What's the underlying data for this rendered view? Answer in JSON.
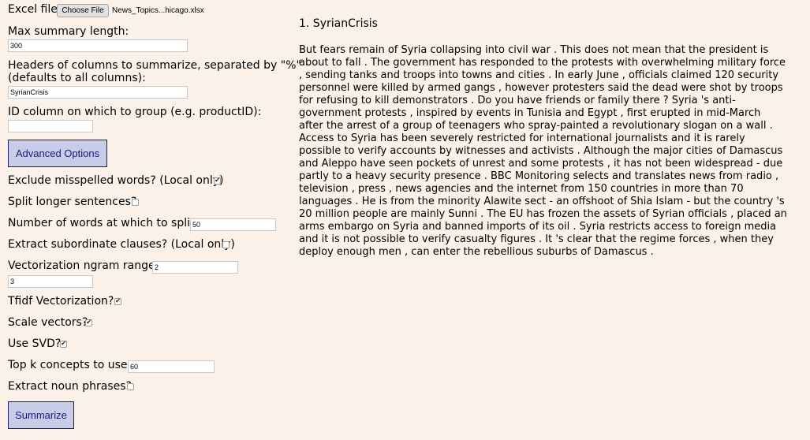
{
  "form": {
    "excel_file_label": "Excel file",
    "choose_file_label": "Choose File",
    "file_name": "News_Topics...hicago.xlsx",
    "max_summary_label": "Max summary length:",
    "max_summary_value": "300",
    "headers_label_line1": "Headers of columns to summarize, separated by \"%\"",
    "headers_label_line2": "(defaults to all columns):",
    "headers_value": "SyrianCrisis",
    "id_column_label": "ID column on which to group (e.g. productID):",
    "id_column_value": "",
    "advanced_options_label": "Advanced Options",
    "exclude_misspelled_label": "Exclude misspelled words? (Local only)",
    "exclude_misspelled_checked": true,
    "split_longer_label": "Split longer sentences?",
    "split_longer_checked": false,
    "words_to_split_label": "Number of words at which to split:",
    "words_to_split_value": "50",
    "extract_subordinate_label": "Extract subordinate clauses? (Local only)",
    "extract_subordinate_checked": false,
    "ngram_label": "Vectorization ngram range:",
    "ngram_min": "2",
    "ngram_max": "3",
    "tfidf_label": "Tfidf Vectorization?",
    "tfidf_checked": true,
    "scale_label": "Scale vectors?",
    "scale_checked": true,
    "svd_label": "Use SVD?",
    "svd_checked": true,
    "top_k_label": "Top k concepts to use:",
    "top_k_value": "60",
    "noun_phrases_label": "Extract noun phrases?",
    "noun_phrases_checked": false,
    "summarize_label": "Summarize"
  },
  "summary": {
    "title": "1. SyrianCrisis",
    "body": "But fears remain of Syria collapsing into civil war . This does not mean that the president is about to fall . The government has responded to the protests with overwhelming military force , sending tanks and troops into towns and cities . In early June , officials claimed 120 security personnel were killed by armed gangs , however protesters said the dead were shot by troops for refusing to kill demonstrators . Do you have friends or family there ? Syria 's anti-government protests , inspired by events in Tunisia and Egypt , first erupted in mid-March after the arrest of a group of teenagers who spray-painted a revolutionary slogan on a wall . Access to Syria has been severely restricted for international journalists and it is rarely possible to verify accounts by witnesses and activists . Although the major cities of Damascus and Aleppo have seen pockets of unrest and some protests , it has not been widespread - due partly to a heavy security presence . BBC Monitoring selects and translates news from radio , television , press , news agencies and the internet from 150 countries in more than 70 languages . He is from the minority Alawite sect - an offshoot of Shia Islam - but the country 's 20 million people are mainly Sunni . The EU has frozen the assets of Syrian officials , placed an arms embargo on Syria and banned imports of its oil . Syria restricts access to foreign media and it is not possible to verify casualty figures . It 's clear that the regime forces , when they deploy enough men , can enter the rebellious suburbs of Damascus ."
  },
  "colors": {
    "background": "#fbf1e9",
    "button_fill": "#c7cde6",
    "button_border": "#1c1c6e",
    "button_text": "#1a1a78"
  }
}
